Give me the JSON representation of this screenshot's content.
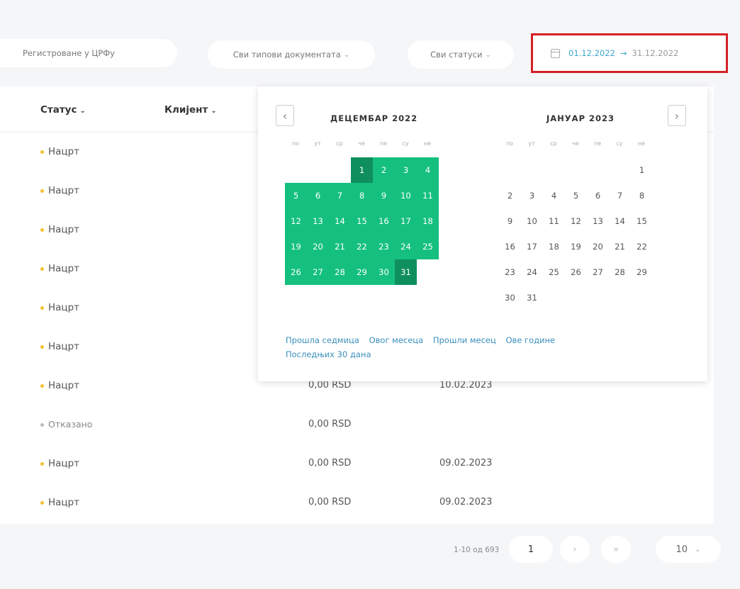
{
  "filters": {
    "registered": "Регистроване у ЦРФу",
    "doc_types": "Сви типови документата",
    "statuses": "Сви статуси",
    "date_start": "01.12.2022",
    "date_arrow": "→",
    "date_end": "31.12.2022"
  },
  "table": {
    "columns": {
      "status": "Статус",
      "client": "Клијент"
    },
    "rows": [
      {
        "status": "Нацрт",
        "amount": "",
        "date": ""
      },
      {
        "status": "Нацрт",
        "amount": "",
        "date": ""
      },
      {
        "status": "Нацрт",
        "amount": "",
        "date": ""
      },
      {
        "status": "Нацрт",
        "amount": "",
        "date": ""
      },
      {
        "status": "Нацрт",
        "amount": "",
        "date": ""
      },
      {
        "status": "Нацрт",
        "amount": "",
        "date": ""
      },
      {
        "status": "Нацрт",
        "amount": "0,00 RSD",
        "date": "10.02.2023"
      },
      {
        "status": "Отказано",
        "amount": "0,00 RSD",
        "date": ""
      },
      {
        "status": "Нацрт",
        "amount": "0,00 RSD",
        "date": "09.02.2023"
      },
      {
        "status": "Нацрт",
        "amount": "0,00 RSD",
        "date": "09.02.2023"
      }
    ]
  },
  "pagination": {
    "count": "1-10 од 693",
    "current_page": "1",
    "next": "›",
    "last": "»",
    "page_size": "10"
  },
  "datepicker": {
    "prev": "‹",
    "next": "›",
    "weekdays": [
      "по",
      "ут",
      "ср",
      "че",
      "пе",
      "су",
      "не"
    ],
    "months": [
      {
        "title": "ДЕЦЕМБАР 2022",
        "days": [
          "1",
          "2",
          "3",
          "4",
          "5",
          "6",
          "7",
          "8",
          "9",
          "10",
          "11",
          "12",
          "13",
          "14",
          "15",
          "16",
          "17",
          "18",
          "19",
          "20",
          "21",
          "22",
          "23",
          "24",
          "25",
          "26",
          "27",
          "28",
          "29",
          "30",
          "31"
        ]
      },
      {
        "title": "ЈАНУАР 2023",
        "days": [
          "1",
          "2",
          "3",
          "4",
          "5",
          "6",
          "7",
          "8",
          "9",
          "10",
          "11",
          "12",
          "13",
          "14",
          "15",
          "16",
          "17",
          "18",
          "19",
          "20",
          "21",
          "22",
          "23",
          "24",
          "25",
          "26",
          "27",
          "28",
          "29",
          "30",
          "31"
        ]
      }
    ],
    "presets": [
      "Прошла седмица",
      "Овог месеца",
      "Прошли месец",
      "Ове године",
      "Последњих 30 дана"
    ]
  },
  "colors": {
    "selected": "#15c07f",
    "range_edge": "#0f8f5e",
    "highlight_border": "#d42026",
    "draft_dot": "#f2c12e"
  }
}
